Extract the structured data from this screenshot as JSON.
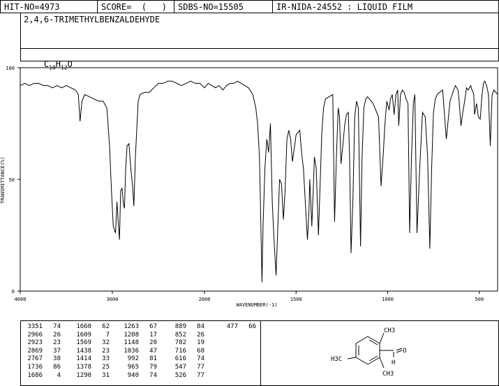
{
  "header": {
    "hit_no": "HIT-NO=4973",
    "score": "SCORE=  (   )",
    "sdbs_no": "SDBS-NO=15505",
    "ir_nida": "IR-NIDA-24552 : LIQUID FILM"
  },
  "compound_name": "2,4,6-TRIMETHYLBENZALDEHYDE",
  "formula": {
    "c": "C",
    "c_n": "10",
    "h": "H",
    "h_n": "12",
    "o": "O"
  },
  "structure_labels": {
    "ch3_top": "CH3",
    "h3c_left": "H3C",
    "ch3_bottom": "CH3",
    "o": "O",
    "h": "H"
  },
  "chart_data": {
    "type": "line",
    "xlabel": "WAVENUMBER(-1)",
    "ylabel": "TRANSMITTANCE(%)",
    "xlim": [
      4000,
      400
    ],
    "ylim": [
      0,
      100
    ],
    "x_ticks": [
      4000,
      3000,
      2000,
      1500,
      1000,
      500
    ],
    "y_ticks": [
      100,
      50,
      0
    ],
    "grid": false,
    "x": [
      4000,
      3950,
      3900,
      3850,
      3800,
      3750,
      3700,
      3650,
      3600,
      3550,
      3500,
      3450,
      3400,
      3370,
      3351,
      3330,
      3300,
      3250,
      3200,
      3150,
      3100,
      3060,
      3030,
      3010,
      2990,
      2966,
      2950,
      2935,
      2923,
      2910,
      2895,
      2880,
      2869,
      2855,
      2840,
      2820,
      2800,
      2780,
      2767,
      2750,
      2720,
      2700,
      2650,
      2600,
      2550,
      2500,
      2450,
      2400,
      2350,
      2300,
      2250,
      2200,
      2150,
      2100,
      2050,
      2000,
      1980,
      1960,
      1940,
      1920,
      1900,
      1880,
      1860,
      1840,
      1820,
      1800,
      1780,
      1760,
      1736,
      1720,
      1710,
      1700,
      1695,
      1686,
      1680,
      1670,
      1660,
      1650,
      1640,
      1630,
      1620,
      1609,
      1600,
      1590,
      1580,
      1569,
      1560,
      1550,
      1540,
      1530,
      1520,
      1500,
      1480,
      1470,
      1460,
      1450,
      1438,
      1430,
      1425,
      1414,
      1405,
      1400,
      1390,
      1378,
      1370,
      1360,
      1350,
      1340,
      1320,
      1300,
      1290,
      1280,
      1270,
      1263,
      1255,
      1245,
      1235,
      1225,
      1215,
      1208,
      1200,
      1190,
      1180,
      1170,
      1160,
      1148,
      1140,
      1130,
      1120,
      1110,
      1100,
      1090,
      1080,
      1070,
      1060,
      1050,
      1036,
      1025,
      1015,
      1005,
      992,
      985,
      975,
      965,
      955,
      945,
      940,
      930,
      920,
      910,
      900,
      889,
      880,
      870,
      860,
      852,
      840,
      825,
      810,
      795,
      782,
      770,
      760,
      750,
      740,
      730,
      716,
      700,
      680,
      660,
      640,
      630,
      616,
      610,
      600,
      590,
      580,
      570,
      560,
      547,
      540,
      530,
      526,
      515,
      505,
      495,
      485,
      477,
      470,
      460,
      450,
      440,
      430,
      420,
      400
    ],
    "y": [
      92,
      93,
      92,
      93,
      93,
      92,
      92,
      91,
      92,
      91,
      92,
      91,
      90,
      88,
      76,
      85,
      88,
      87,
      86,
      85,
      85,
      82,
      65,
      45,
      29,
      26,
      40,
      30,
      23,
      45,
      46,
      39,
      37,
      55,
      65,
      66,
      55,
      47,
      38,
      60,
      85,
      88,
      89,
      89,
      91,
      93,
      93,
      94,
      94,
      93,
      92,
      93,
      94,
      93,
      93,
      91,
      93,
      92,
      91,
      92,
      90,
      92,
      93,
      93,
      94,
      93,
      92,
      91,
      88,
      82,
      75,
      60,
      40,
      4,
      30,
      55,
      68,
      62,
      75,
      40,
      22,
      7,
      28,
      50,
      48,
      32,
      45,
      68,
      72,
      68,
      58,
      70,
      72,
      62,
      55,
      40,
      23,
      35,
      50,
      29,
      48,
      60,
      55,
      25,
      45,
      70,
      82,
      86,
      87,
      88,
      31,
      60,
      82,
      78,
      57,
      65,
      74,
      79,
      80,
      60,
      17,
      40,
      78,
      85,
      82,
      20,
      60,
      82,
      86,
      87,
      86,
      85,
      84,
      82,
      80,
      78,
      47,
      60,
      75,
      85,
      81,
      86,
      88,
      79,
      88,
      90,
      74,
      88,
      90,
      89,
      86,
      84,
      26,
      60,
      84,
      88,
      26,
      55,
      80,
      78,
      60,
      19,
      55,
      80,
      86,
      88,
      89,
      90,
      68,
      85,
      90,
      92,
      90,
      85,
      74,
      80,
      85,
      91,
      90,
      92,
      90,
      88,
      79,
      84,
      78,
      77,
      88,
      93,
      94,
      92,
      88,
      65,
      88,
      90,
      88,
      85,
      74
    ]
  },
  "peak_table": {
    "columns": [
      {
        "w": [
          "3351",
          "2966",
          "2923",
          "2869",
          "2767",
          "1736",
          "1686"
        ],
        "t": [
          "74",
          "26",
          "23",
          "37",
          "38",
          "86",
          "4"
        ]
      },
      {
        "w": [
          "1660",
          "1609",
          "1569",
          "1438",
          "1414",
          "1378",
          "1290"
        ],
        "t": [
          "62",
          "7",
          "32",
          "23",
          "33",
          "25",
          "31"
        ]
      },
      {
        "w": [
          "1263",
          "1208",
          "1148",
          "1036",
          "992",
          "965",
          "940"
        ],
        "t": [
          "67",
          "17",
          "20",
          "47",
          "81",
          "79",
          "74"
        ]
      },
      {
        "w": [
          "889",
          "852",
          "782",
          "716",
          "616",
          "547",
          "526"
        ],
        "t": [
          "84",
          "26",
          "19",
          "68",
          "74",
          "77",
          "77"
        ]
      },
      {
        "w": [
          "477"
        ],
        "t": [
          "66"
        ]
      }
    ]
  }
}
